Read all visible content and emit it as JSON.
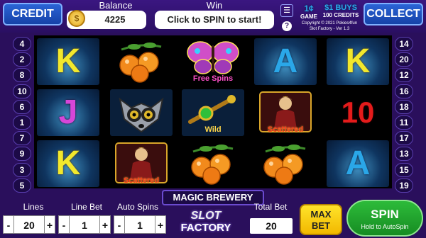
{
  "header": {
    "credit_label": "CREDIT",
    "collect_label": "COLLECT",
    "balance_label": "Balance",
    "balance_value": "4225",
    "win_label": "Win",
    "win_prompt": "Click to SPIN to start!",
    "denomination": "1¢",
    "denomination_sub": "GAME",
    "buys_line1": "$1 BUYS",
    "buys_line2": "100 CREDITS",
    "copyright_line1": "Copyright © 2021 Pokies4fun",
    "copyright_line2": "Slot Factory - Ver 1.3"
  },
  "paylines": {
    "left": [
      "4",
      "2",
      "8",
      "10",
      "6",
      "1",
      "7",
      "9",
      "3",
      "5"
    ],
    "right": [
      "14",
      "20",
      "12",
      "16",
      "18",
      "11",
      "17",
      "13",
      "15",
      "19"
    ]
  },
  "reels": [
    [
      "K",
      "J",
      "K"
    ],
    [
      "orange-berries",
      "lemur-mask",
      "scatter-hero"
    ],
    [
      "butterfly-free-spins",
      "wild-key",
      "orange-berries"
    ],
    [
      "A",
      "scatter-hero",
      "orange-berries"
    ],
    [
      "K",
      "10",
      "A"
    ]
  ],
  "symbol_text": {
    "free_spins": "Free Spins",
    "scattered": "Scattered",
    "wild": "Wild"
  },
  "game_name": "MAGIC BREWERY",
  "controls": {
    "lines_label": "Lines",
    "lines_value": "20",
    "line_bet_label": "Line Bet",
    "line_bet_value": "1",
    "auto_spins_label": "Auto Spins",
    "auto_spins_value": "1",
    "plus": "+",
    "minus": "-",
    "total_bet_label": "Total Bet",
    "total_bet_value": "20",
    "max_bet_line1": "MAX",
    "max_bet_line2": "BET",
    "spin_label": "SPIN",
    "spin_sub": "Hold to AutoSpin",
    "logo_line1": "SLOT",
    "logo_line2": "FACTORY"
  },
  "colors": {
    "background": "#2a0f5c",
    "credit_button": "#2b64d6",
    "spin_button": "#2dbb3a",
    "max_bet_button": "#ffe42a"
  }
}
